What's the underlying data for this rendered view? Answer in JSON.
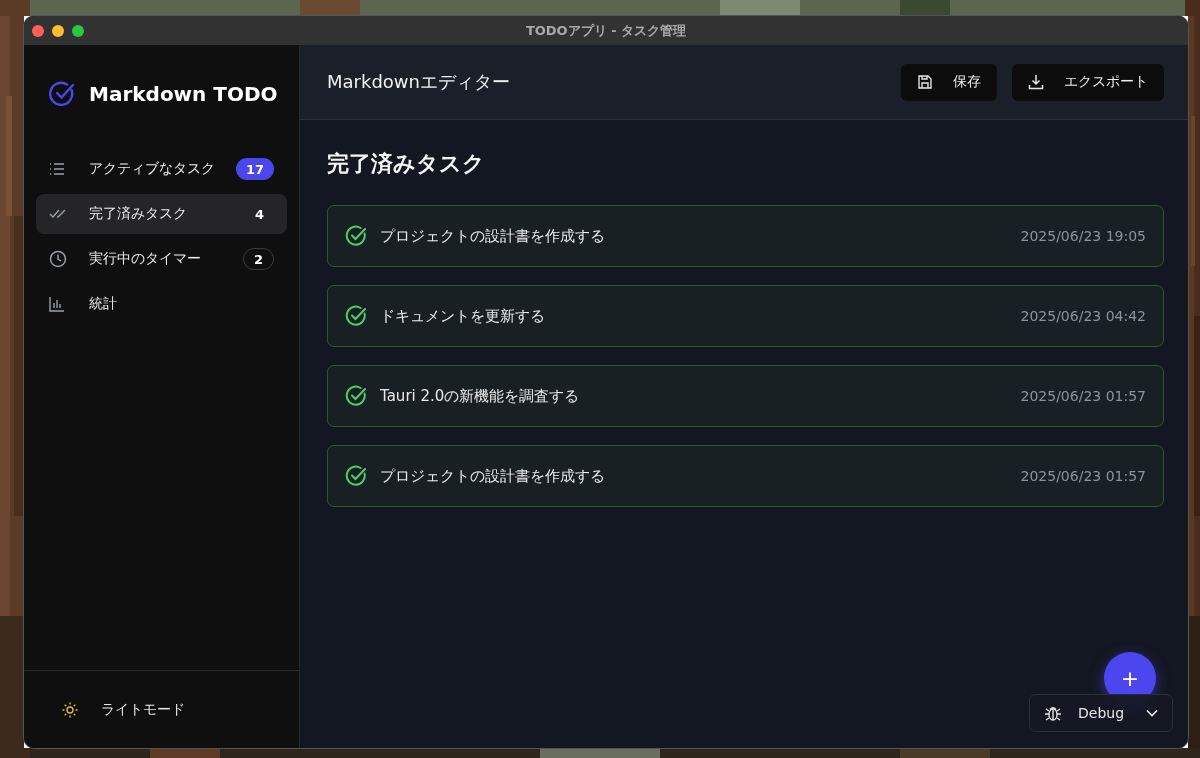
{
  "window": {
    "title": "TODOアプリ - タスク管理"
  },
  "sidebar": {
    "app_name": "Markdown TODO",
    "items": [
      {
        "kind": "list",
        "label": "アクティブなタスク",
        "count": "17",
        "highlighted": true,
        "outlined": false,
        "selected": false
      },
      {
        "kind": "done",
        "label": "完了済みタスク",
        "count": "4",
        "highlighted": false,
        "outlined": false,
        "selected": true
      },
      {
        "kind": "timer",
        "label": "実行中のタイマー",
        "count": "2",
        "highlighted": false,
        "outlined": true,
        "selected": false
      },
      {
        "kind": "stats",
        "label": "統計",
        "selected": false
      }
    ],
    "theme_toggle": "ライトモード"
  },
  "header": {
    "title": "Markdownエディター",
    "buttons": [
      {
        "kind": "save",
        "label": "保存"
      },
      {
        "kind": "export",
        "label": "エクスポート"
      }
    ]
  },
  "content": {
    "heading": "完了済みタスク",
    "tasks": [
      {
        "title": "プロジェクトの設計書を作成する",
        "completed_at": "2025/06/23 19:05",
        "done": true
      },
      {
        "title": "ドキュメントを更新する",
        "completed_at": "2025/06/23 04:42",
        "done": true
      },
      {
        "title": "Tauri 2.0の新機能を調査する",
        "completed_at": "2025/06/23 01:57",
        "done": true
      },
      {
        "title": "プロジェクトの設計書を作成する",
        "completed_at": "2025/06/23 01:57",
        "done": true
      }
    ]
  },
  "fab": {
    "label": "+"
  },
  "debug": {
    "label": "Debug"
  }
}
